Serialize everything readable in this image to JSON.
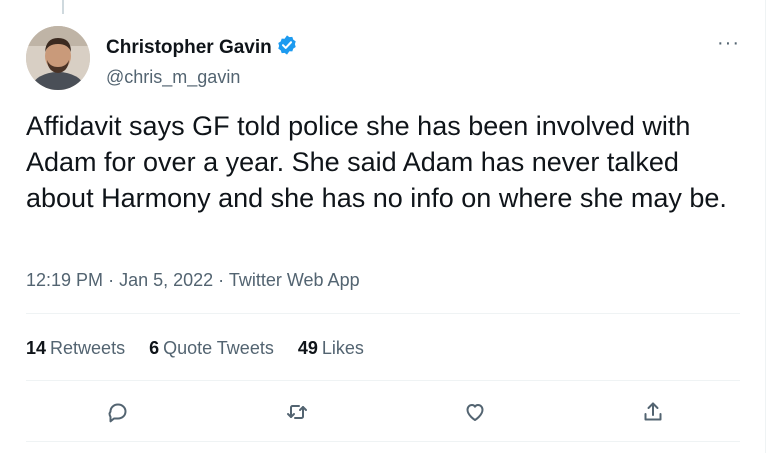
{
  "tweet": {
    "author": {
      "display_name": "Christopher Gavin",
      "handle": "@chris_m_gavin",
      "verified": true
    },
    "text": "Affidavit says GF told police she has been involved with Adam for over a year. She said Adam has never talked about Harmony and she has no info on where she may be.",
    "time": "12:19 PM",
    "date": "Jan 5, 2022",
    "source": "Twitter Web App",
    "separator": "·",
    "more_label": "···",
    "stats": {
      "retweets_count": "14",
      "retweets_label": "Retweets",
      "quote_count": "6",
      "quote_label": "Quote Tweets",
      "likes_count": "49",
      "likes_label": "Likes"
    },
    "actions": [
      "reply-icon",
      "retweet-icon",
      "like-icon",
      "share-icon"
    ]
  },
  "colors": {
    "text_primary": "#0f1419",
    "text_secondary": "#536471",
    "verified_blue": "#1d9bf0",
    "divider": "#eff3f4"
  }
}
